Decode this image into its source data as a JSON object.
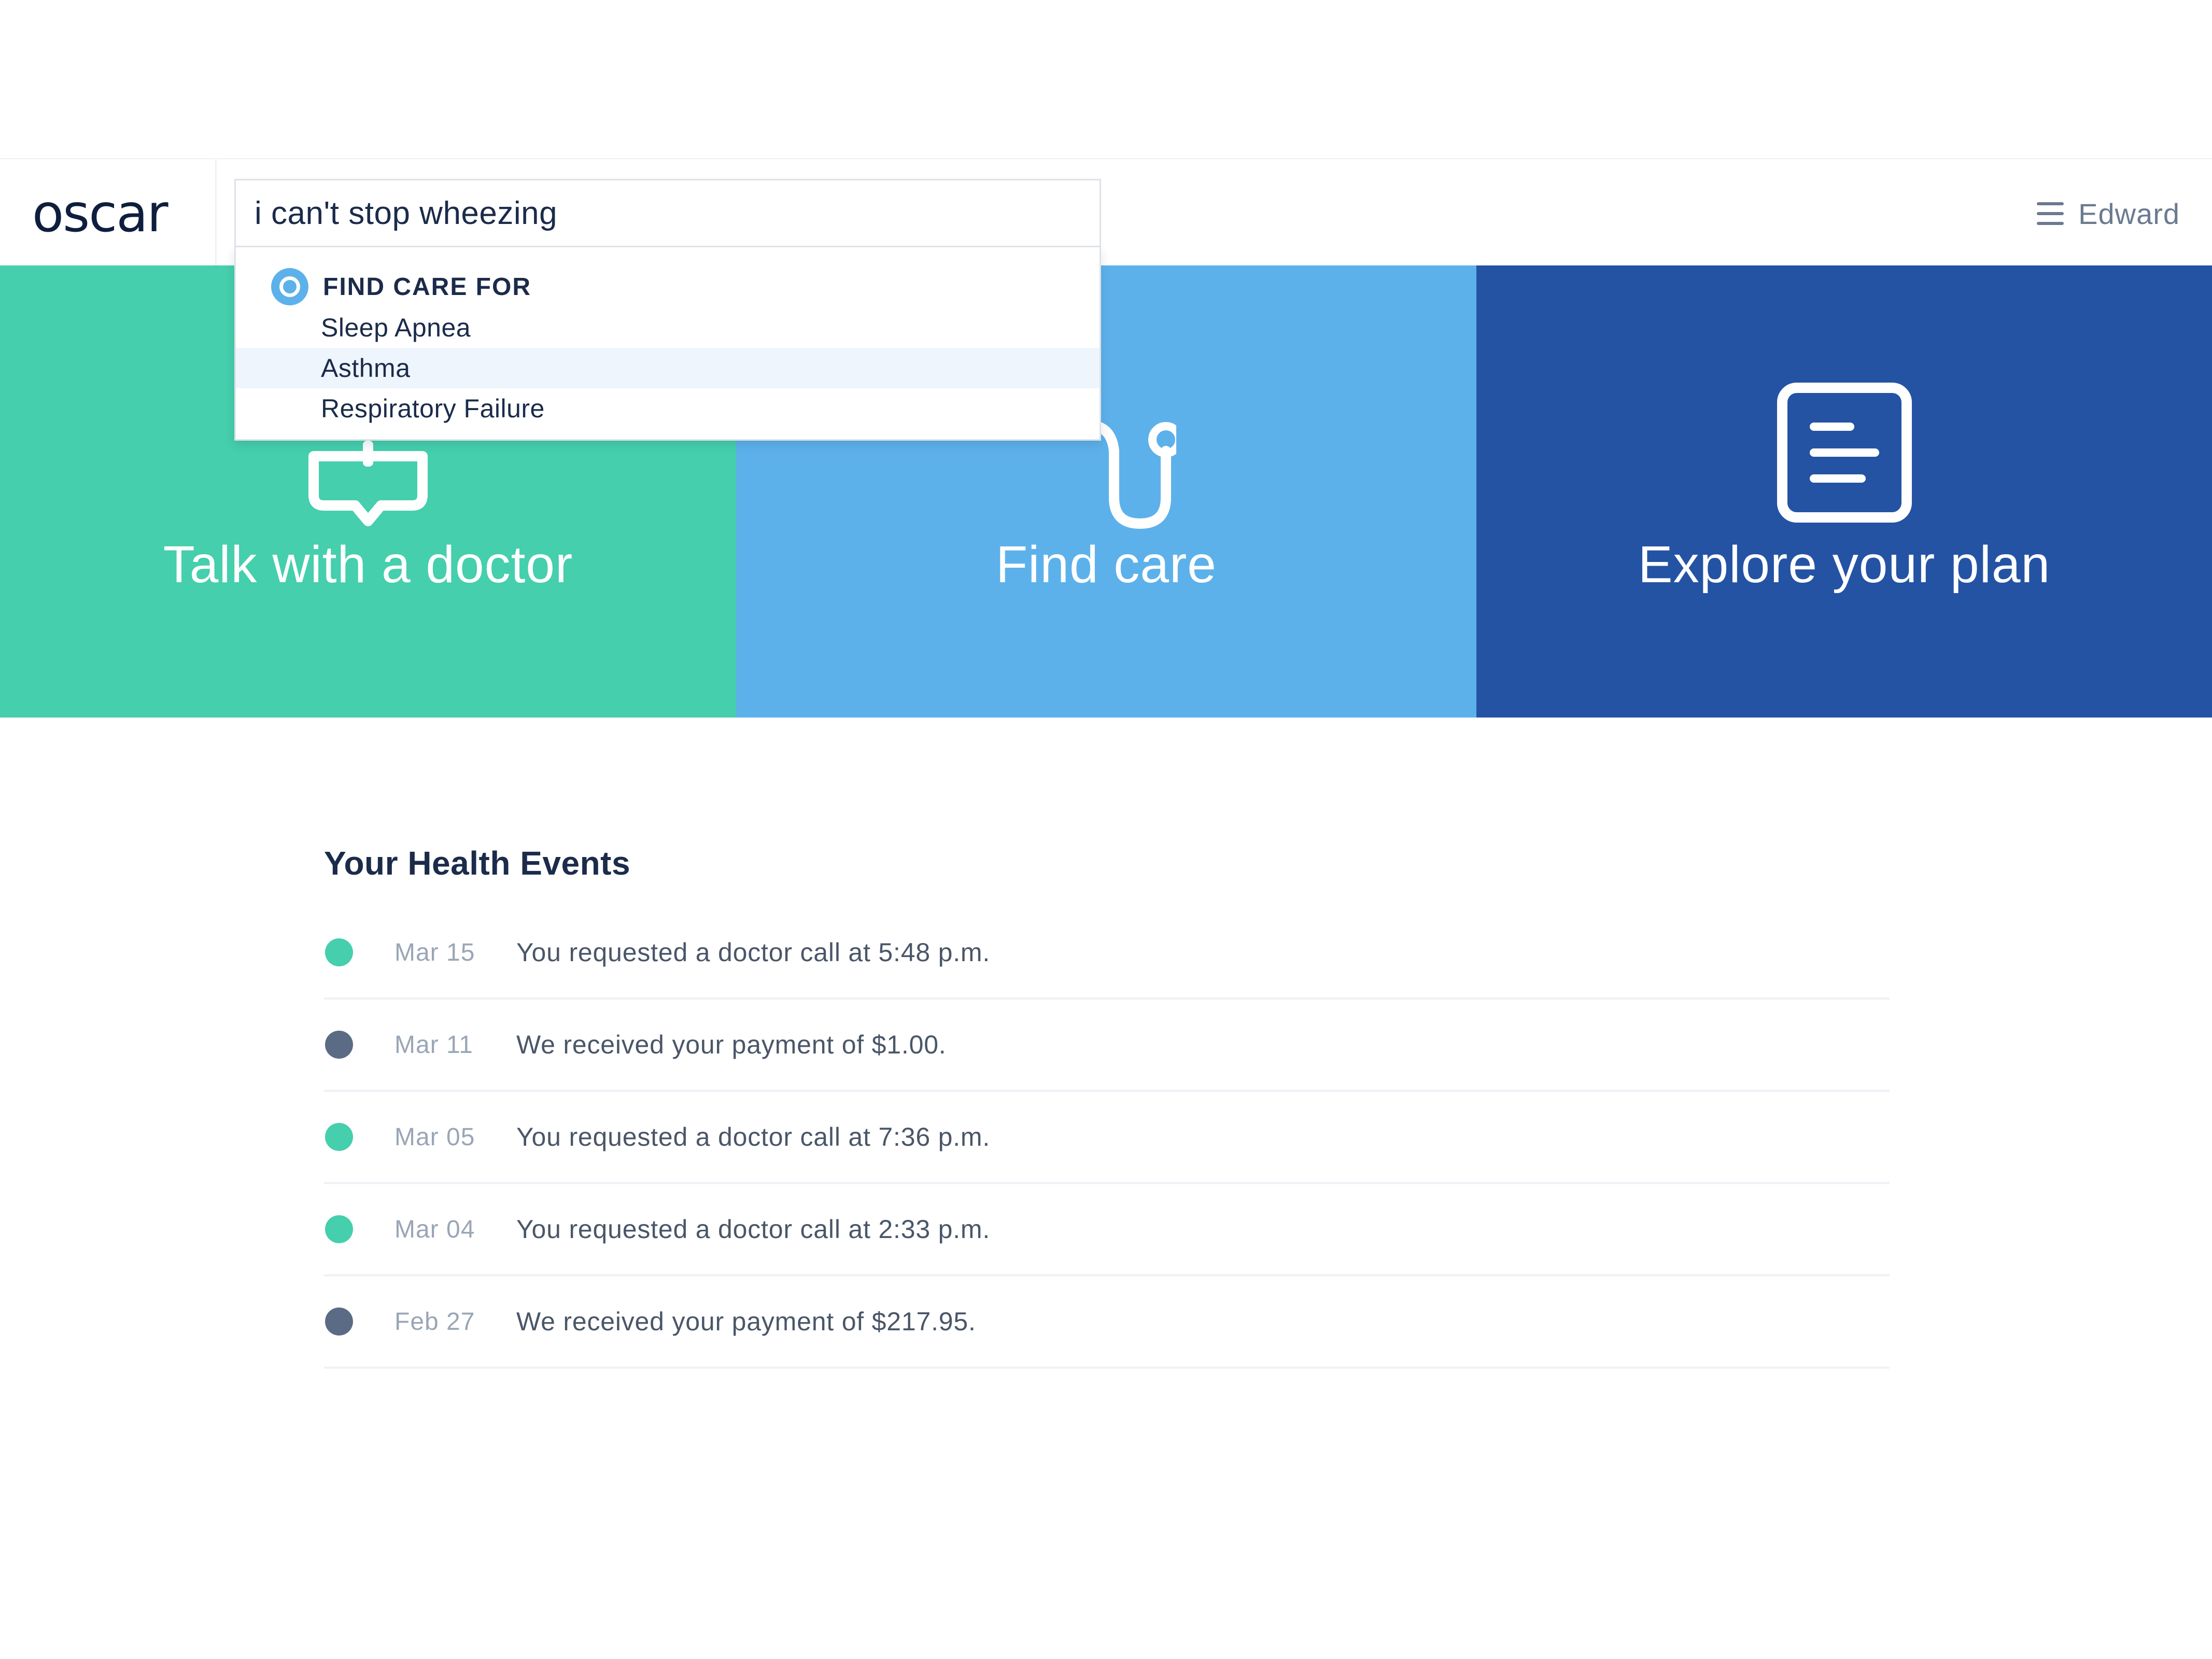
{
  "header": {
    "logo": "oscar",
    "user_name": "Edward",
    "menu_icon": "hamburger-menu-icon"
  },
  "search": {
    "value": "i can't stop wheezing",
    "dropdown": {
      "section_label": "FIND CARE FOR",
      "section_icon": "target-icon",
      "items": [
        {
          "label": "Sleep Apnea",
          "active": false
        },
        {
          "label": "Asthma",
          "active": true
        },
        {
          "label": "Respiratory Failure",
          "active": false
        }
      ]
    }
  },
  "tiles": [
    {
      "label": "Talk with a doctor",
      "icon": "speech-bubble-icon",
      "color": "#45cfac"
    },
    {
      "label": "Find care",
      "icon": "stethoscope-icon",
      "color": "#5db1ea"
    },
    {
      "label": "Explore your plan",
      "icon": "document-icon",
      "color": "#2453a4"
    }
  ],
  "health_events": {
    "title": "Your Health Events",
    "colors": {
      "doctor_call": "#45cfac",
      "payment": "#5b6b85"
    },
    "events": [
      {
        "date": "Mar 15",
        "text": "You requested a doctor call at 5:48 p.m.",
        "type": "doctor_call"
      },
      {
        "date": "Mar 11",
        "text": "We received your payment of $1.00.",
        "type": "payment"
      },
      {
        "date": "Mar 05",
        "text": "You requested a doctor call at 7:36 p.m.",
        "type": "doctor_call"
      },
      {
        "date": "Mar 04",
        "text": "You requested a doctor call at 2:33 p.m.",
        "type": "doctor_call"
      },
      {
        "date": "Feb 27",
        "text": "We received your payment of $217.95.",
        "type": "payment"
      }
    ]
  }
}
